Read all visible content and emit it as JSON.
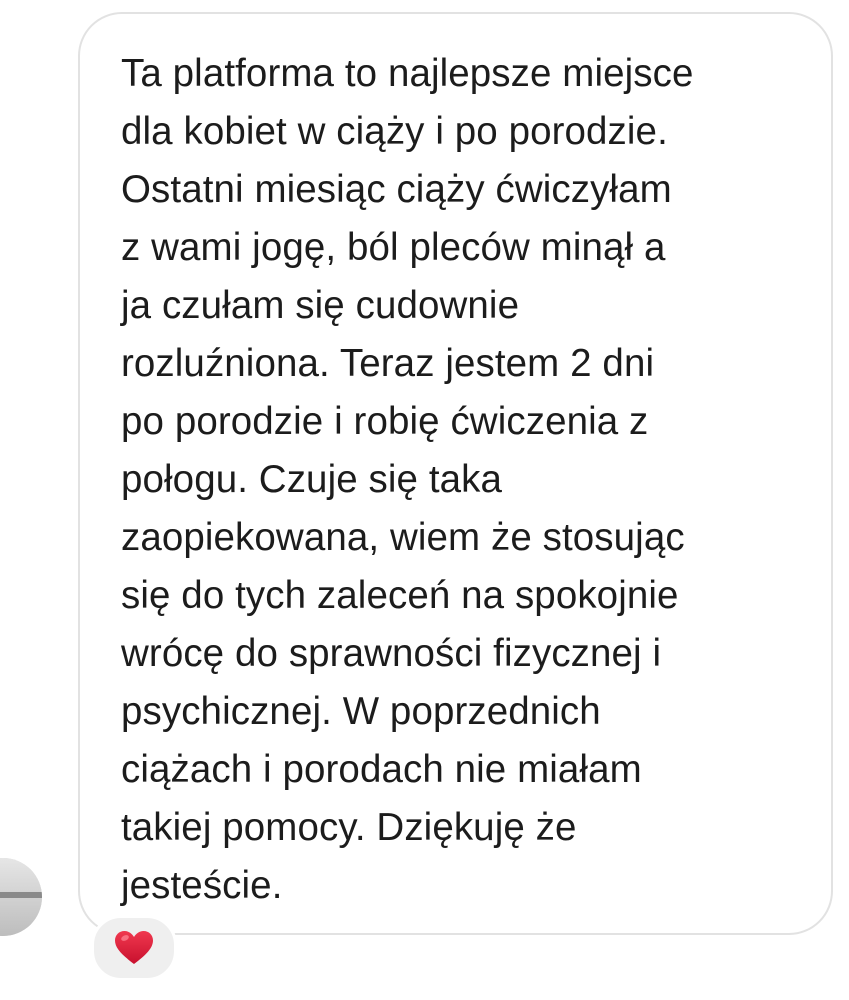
{
  "message": {
    "text": "Ta platforma to najlepsze miejsce\ndla kobiet w ciąży i po porodzie.\nOstatni miesiąc ciąży ćwiczyłam\nz wami jogę, ból pleców minął a\nja czułam się cudownie\nrozluźniona. Teraz jestem 2 dni\npo porodzie i robię ćwiczenia z\npołogu. Czuje się taka\nzaopiekowana, wiem że stosując\nsię do tych zaleceń na spokojnie\nwrócę do sprawności fizycznej i\npsychicznej. W poprzednich\nciążach i porodach nie miałam\ntakiej pomocy. Dziękuję że\njesteście.",
    "reaction": "heart-emoji",
    "reaction_color": "#e0203a",
    "bubble_border_color": "#e2e2e2",
    "text_color": "#1c1c1c"
  },
  "sender": {
    "avatar": "profile-photo"
  }
}
